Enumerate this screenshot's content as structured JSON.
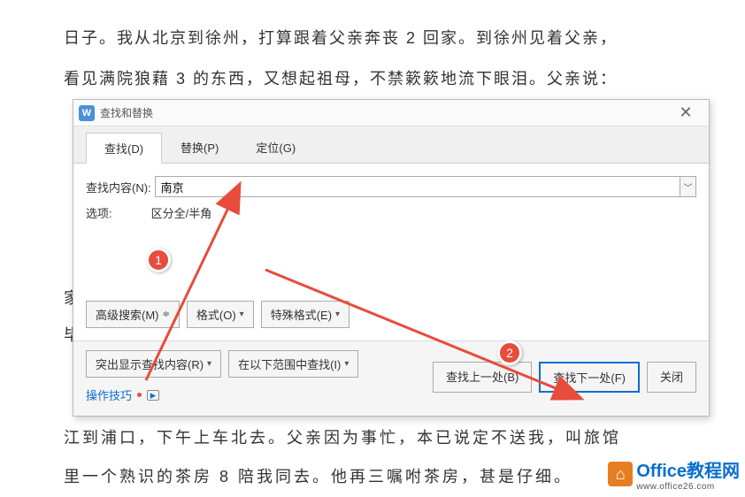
{
  "background": {
    "line1": "日子。我从北京到徐州，打算跟着父亲奔丧 2 回家。到徐州见着父亲，",
    "line2": "看见满院狼藉 3 的东西，又想起祖母，不禁簌簌地流下眼泪。父亲说：",
    "line3": "家",
    "line4": "毕",
    "line5": "江到浦口，下午上车北去。父亲因为事忙，本已说定不送我，叫旅馆",
    "line6": "里一个熟识的茶房 8 陪我同去。他再三嘱咐茶房，甚是仔细。"
  },
  "dialog": {
    "title": "查找和替换",
    "tabs": {
      "find": "查找(D)",
      "replace": "替换(P)",
      "goto": "定位(G)"
    },
    "find_label": "查找内容(N):",
    "find_value": "南京",
    "options_label": "选项:",
    "options_value": "区分全/半角",
    "btn_advanced": "高级搜索(M)",
    "btn_format": "格式(O)",
    "btn_special": "特殊格式(E)",
    "btn_highlight": "突出显示查找内容(R)",
    "btn_searchin": "在以下范围中查找(I)",
    "tips": "操作技巧",
    "btn_prev": "查找上一处(B)",
    "btn_next": "查找下一处(F)",
    "btn_close": "关闭"
  },
  "annotations": {
    "badge1": "1",
    "badge2": "2"
  },
  "watermark": {
    "title": "Office教程网",
    "url": "www.office26.com"
  }
}
